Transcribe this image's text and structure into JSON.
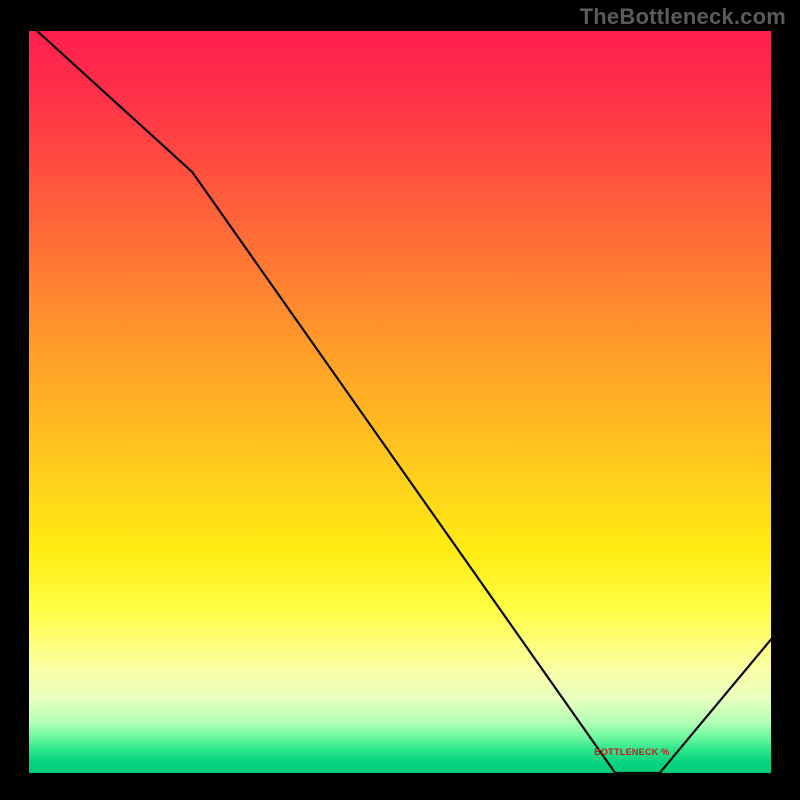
{
  "watermark": "TheBottleneck.com",
  "series_label": "BOTTLENECK %",
  "colors": {
    "curve": "#0a0a0a",
    "label": "#c02020",
    "gradient_top": "#ff1f4f",
    "gradient_bottom": "#00cf7a"
  },
  "chart_data": {
    "type": "line",
    "title": "",
    "xlabel": "",
    "ylabel": "",
    "xlim": [
      0,
      100
    ],
    "ylim": [
      0,
      100
    ],
    "y_direction": "down_is_better",
    "gradient": "green_bottom_red_top",
    "series": [
      {
        "name": "bottleneck-percent",
        "x": [
          0,
          22,
          79,
          85,
          100
        ],
        "values": [
          101,
          81,
          0,
          0,
          18
        ]
      }
    ],
    "annotations": [
      {
        "text": "BOTTLENECK %",
        "x": 82,
        "y": 3
      }
    ]
  }
}
